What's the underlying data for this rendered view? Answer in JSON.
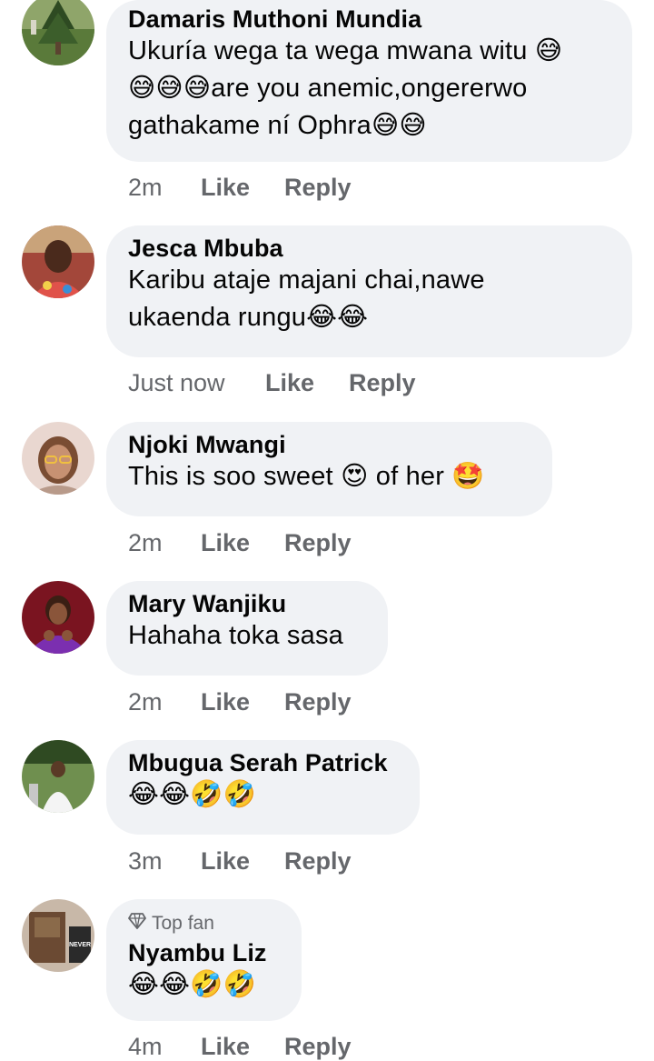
{
  "comments": [
    {
      "name": "Damaris Muthoni Mundia",
      "lines": [
        "Ukuría wega ta wega mwana witu 😅",
        "😅😅😅are you anemic,ongererwo",
        "gathakame ní Ophra😅😅"
      ],
      "time": "2m",
      "like": "Like",
      "reply": "Reply"
    },
    {
      "name": "Jesca Mbuba",
      "lines": [
        "Karibu ataje majani chai,nawe",
        "ukaenda rungu😂😂"
      ],
      "time": "Just now",
      "like": "Like",
      "reply": "Reply"
    },
    {
      "name": "Njoki Mwangi",
      "lines": [
        "This is soo sweet 😍 of her 🤩"
      ],
      "time": "2m",
      "like": "Like",
      "reply": "Reply"
    },
    {
      "name": "Mary Wanjiku",
      "lines": [
        "Hahaha toka sasa"
      ],
      "time": "2m",
      "like": "Like",
      "reply": "Reply"
    },
    {
      "name": "Mbugua Serah Patrick",
      "lines": [
        "😂😂🤣🤣"
      ],
      "time": "3m",
      "like": "Like",
      "reply": "Reply"
    },
    {
      "badge": "Top fan",
      "name": "Nyambu Liz",
      "lines": [
        "😂😂🤣🤣"
      ],
      "time": "4m",
      "like": "Like",
      "reply": "Reply"
    }
  ],
  "avatar_texts": {
    "never_give_up": "NEVER GIVE UP"
  },
  "colors": {
    "bubble": "#f0f2f5",
    "meta": "#65676b",
    "text": "#050505"
  },
  "icons": {
    "top_fan": "diamond-icon"
  }
}
